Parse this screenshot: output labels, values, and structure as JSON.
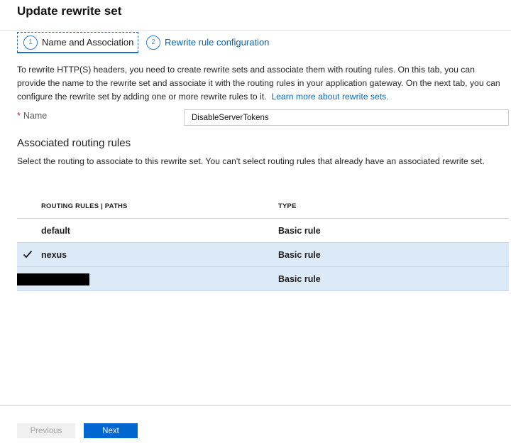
{
  "page": {
    "title": "Update rewrite set"
  },
  "tabs": [
    {
      "step": "1",
      "label": "Name and Association"
    },
    {
      "step": "2",
      "label": "Rewrite rule configuration"
    }
  ],
  "intro": {
    "text": "To rewrite HTTP(S) headers, you need to create rewrite sets and associate them with routing rules. On this tab, you can provide the name to the rewrite set and associate it with the routing rules in your application gateway. On the next tab, you can configure the rewrite set by adding one or more rewrite rules to it.",
    "link": "Learn more about rewrite sets."
  },
  "name_field": {
    "required_mark": "*",
    "label": "Name",
    "value": "DisableServerTokens"
  },
  "routing": {
    "title": "Associated routing rules",
    "description": "Select the routing to associate to this rewrite set. You can't select routing rules that already have an associated rewrite set.",
    "columns": {
      "rules": "ROUTING RULES | PATHS",
      "type": "TYPE"
    },
    "rows": [
      {
        "name": "default",
        "type": "Basic rule",
        "selected": false
      },
      {
        "name": "nexus",
        "type": "Basic rule",
        "selected": true
      },
      {
        "name": "",
        "type": "Basic rule",
        "selected": true,
        "redacted": true
      }
    ]
  },
  "footer": {
    "previous": "Previous",
    "next": "Next"
  },
  "colors": {
    "accent": "#0066d0",
    "selected_row": "#dce9f7",
    "link": "#0a68be",
    "required": "#c0282d"
  }
}
